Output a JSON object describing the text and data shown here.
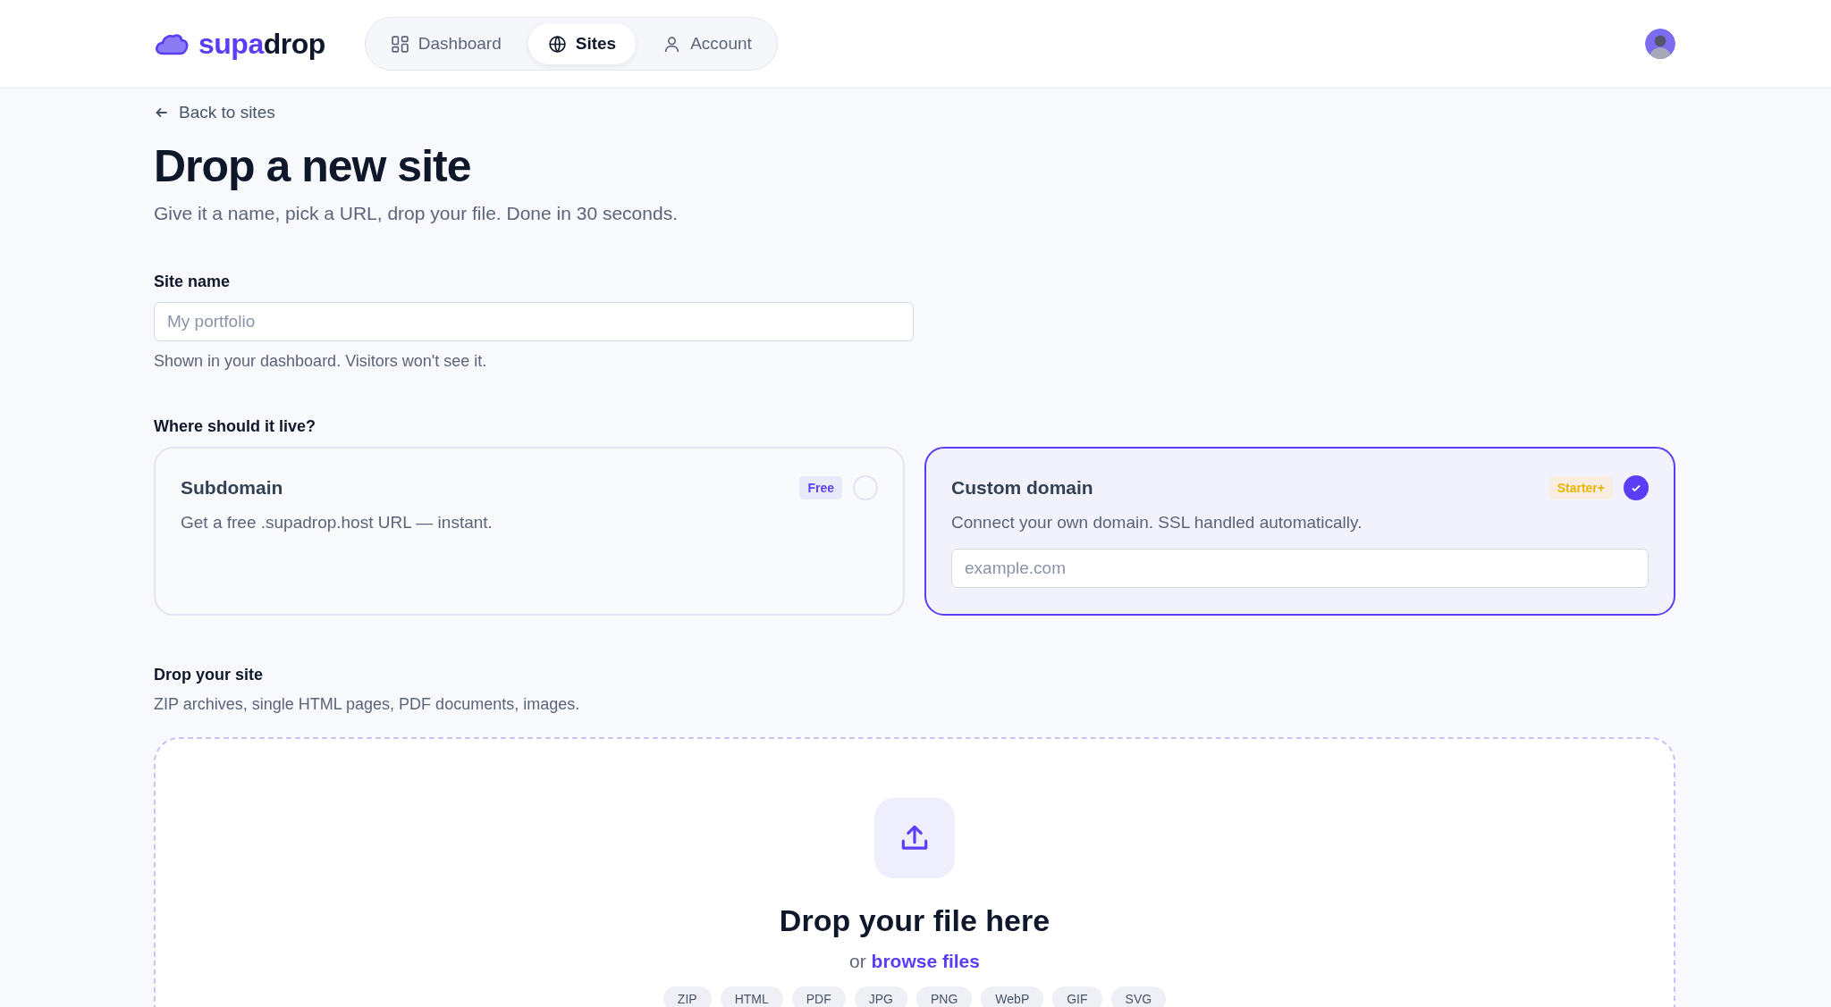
{
  "header": {
    "logo": {
      "part_1": "supa",
      "part_2": "drop"
    },
    "nav": [
      {
        "label": "Dashboard",
        "kind": "grid",
        "selected": false
      },
      {
        "label": "Sites",
        "kind": "globe",
        "selected": true
      },
      {
        "label": "Account",
        "kind": "user",
        "selected": false
      }
    ]
  },
  "back_link": "Back to sites",
  "title": "Drop a new site",
  "subtitle": "Give it a name, pick a URL, drop your file. Done in 30 seconds.",
  "site_name": {
    "label": "Site name",
    "placeholder": "My portfolio",
    "help": "Shown in your dashboard. Visitors won't see it."
  },
  "location": {
    "label": "Where should it live?",
    "options": [
      {
        "title": "Subdomain",
        "description": "Get a free .supadrop.host URL — instant.",
        "badge": "Free",
        "kind": "free",
        "selected": false
      },
      {
        "title": "Custom domain",
        "description": "Connect your own domain. SSL handled automatically.",
        "badge": "Starter+",
        "kind": "paid",
        "selected": true,
        "placeholder": "example.com"
      }
    ]
  },
  "upload": {
    "label": "Drop your site",
    "description": "ZIP archives, single HTML pages, PDF documents, images.",
    "drop_title": "Drop your file here",
    "or": "or",
    "browse": "browse files",
    "formats": [
      "ZIP",
      "HTML",
      "PDF",
      "JPG",
      "PNG",
      "WebP",
      "GIF",
      "SVG"
    ]
  }
}
